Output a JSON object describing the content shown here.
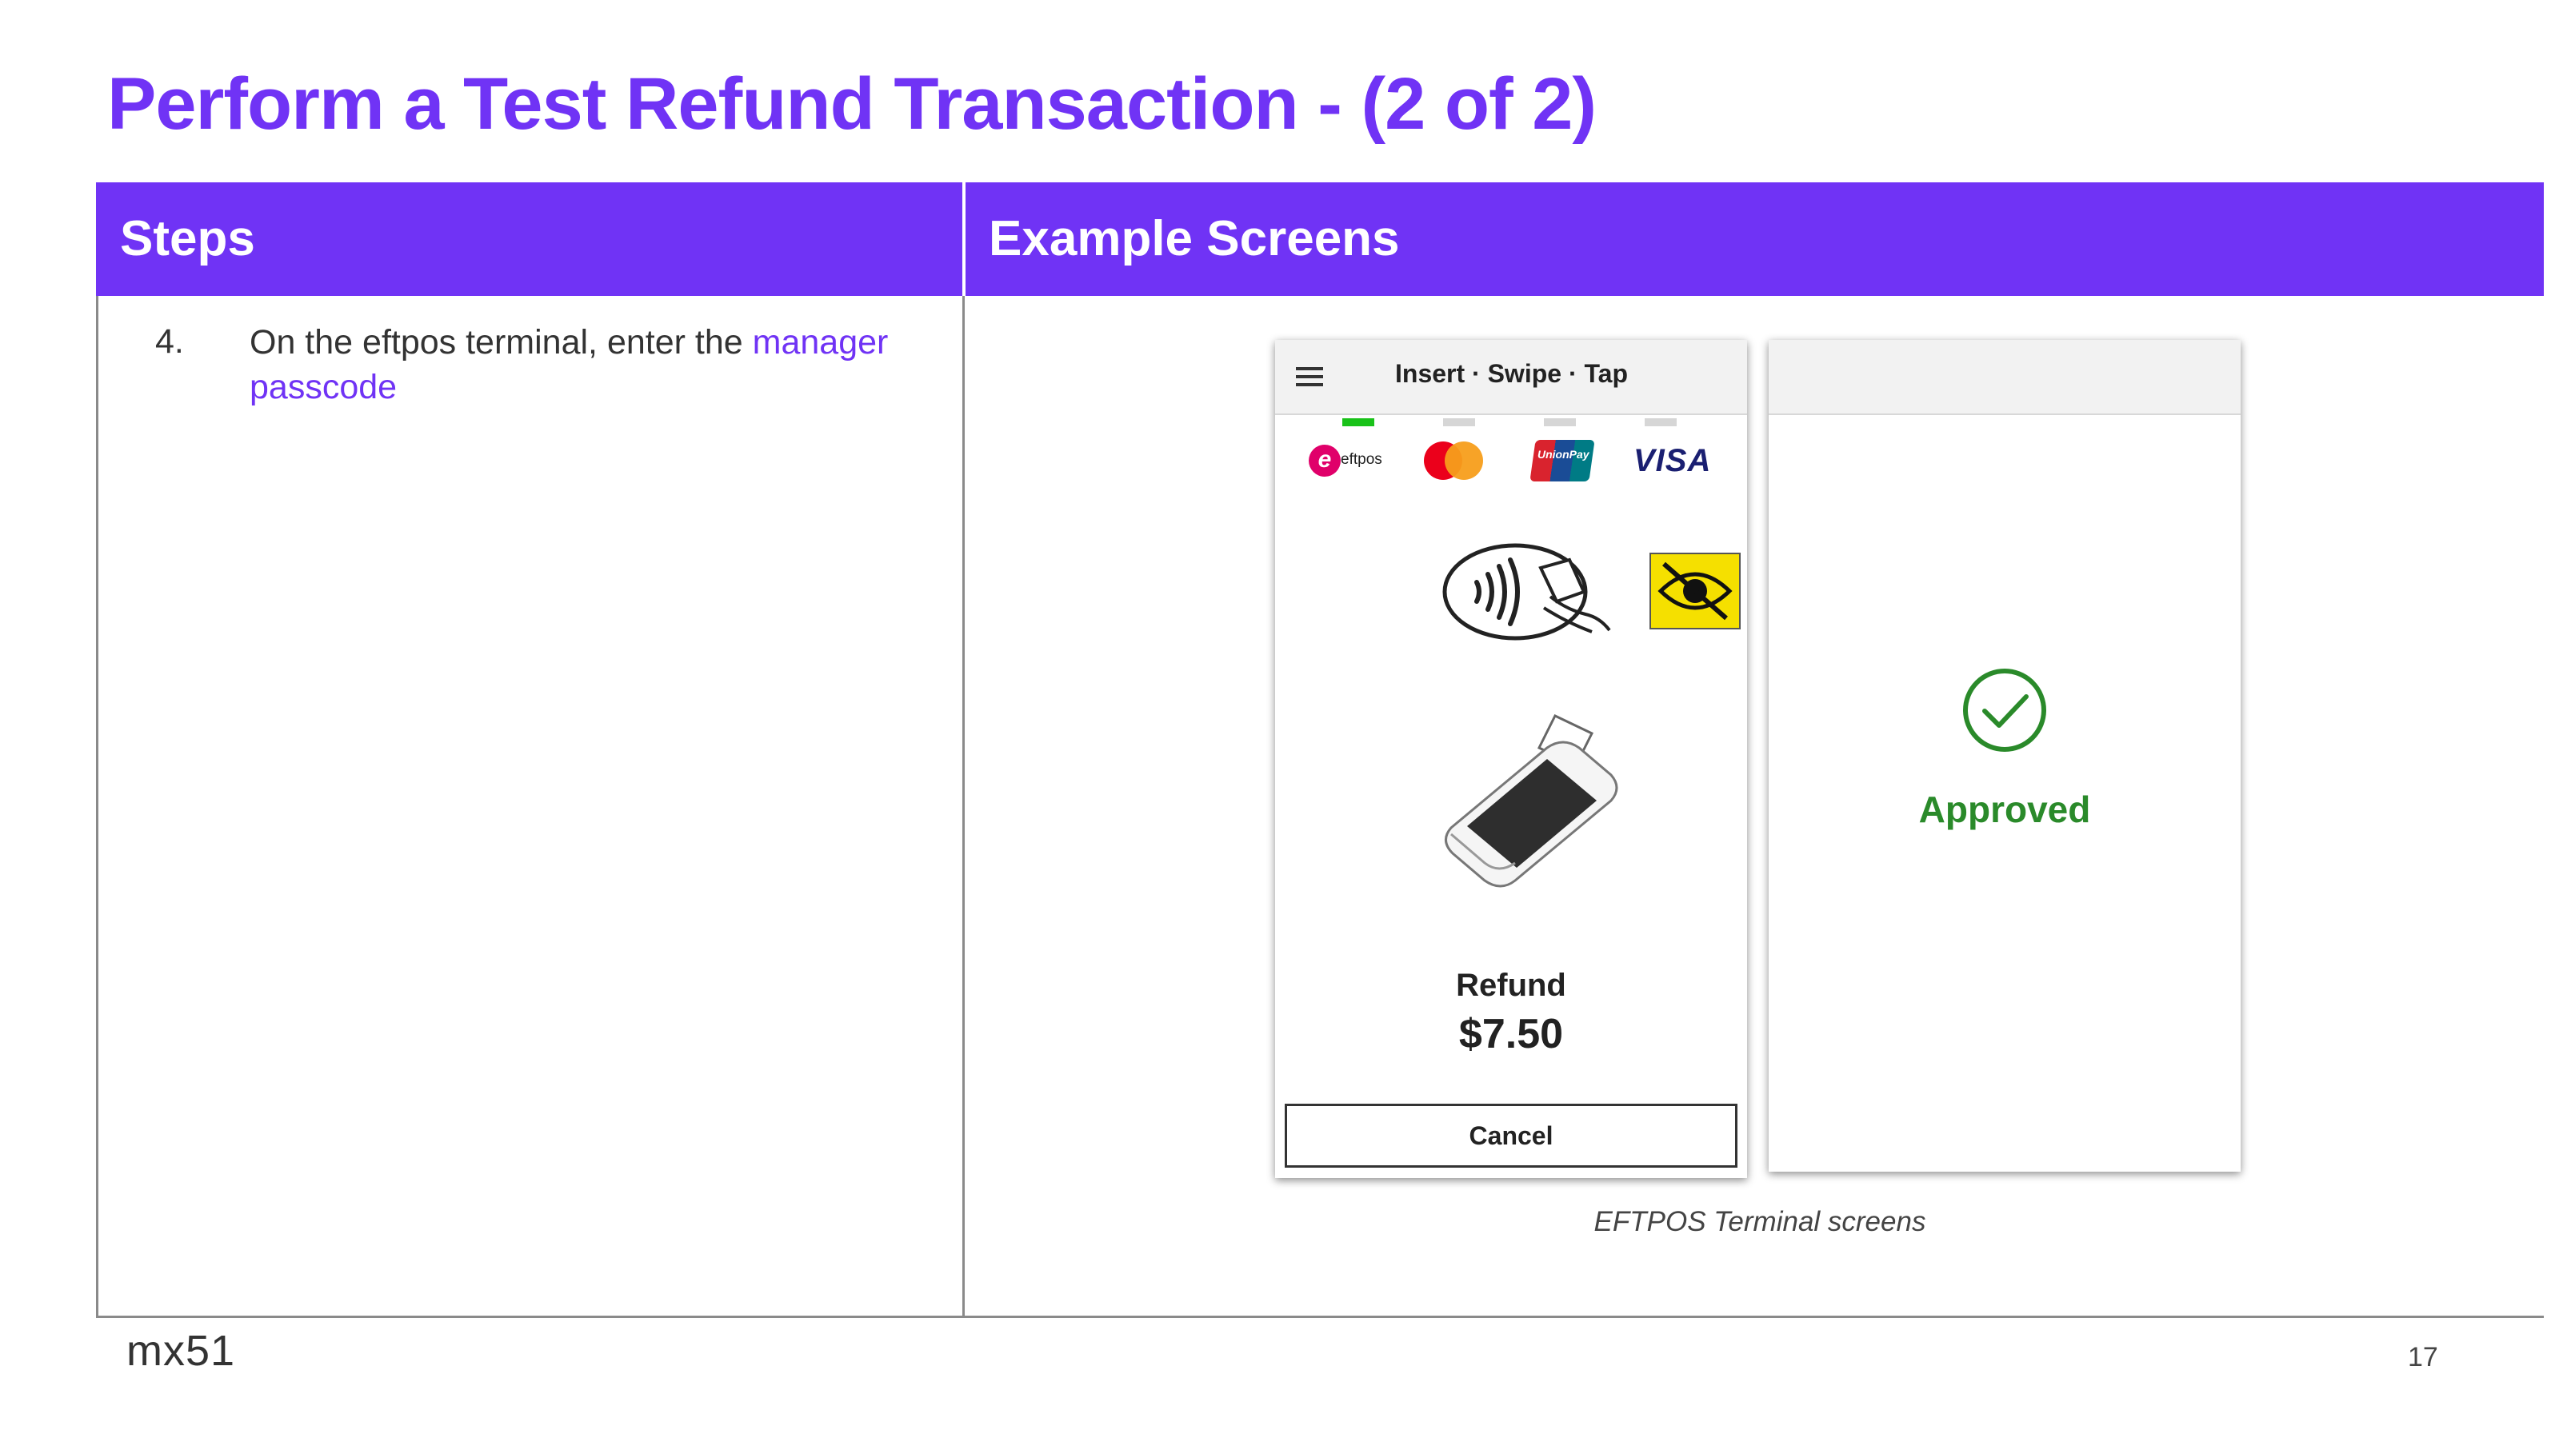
{
  "slide": {
    "title": "Perform a Test Refund Transaction - (2 of 2)",
    "page_number": "17",
    "footer_logo": "mx51"
  },
  "table": {
    "headers": [
      "Steps",
      "Example Screens"
    ],
    "steps": [
      {
        "number": "4.",
        "text_before": "On the eftpos terminal, enter the ",
        "highlight": "manager passcode",
        "highlight_color": "#7033f5"
      }
    ]
  },
  "terminal_screens": {
    "payment_screen": {
      "title": "Insert · Swipe · Tap",
      "menu_icon": "hamburger-menu-icon",
      "brands": [
        {
          "name": "eftpos",
          "icon": "eftpos-logo-icon"
        },
        {
          "name": "mastercard",
          "icon": "mastercard-logo-icon"
        },
        {
          "name": "UnionPay",
          "icon": "unionpay-logo-icon"
        },
        {
          "name": "VISA",
          "icon": "visa-logo-icon"
        }
      ],
      "active_indicator": 0,
      "indicator_colors": {
        "active": "#19c219",
        "inactive": "#d6d6d6"
      },
      "contactless_icon": "contactless-tap-icon",
      "accessibility_icon": "no-eye-icon",
      "device_icon": "payment-terminal-icon",
      "transaction_type": "Refund",
      "amount": "$7.50",
      "cancel_label": "Cancel"
    },
    "result_screen": {
      "status_icon": "check-circle-icon",
      "status": "Approved",
      "status_color": "#2a8a2a"
    },
    "caption": "EFTPOS Terminal screens"
  },
  "colors": {
    "accent": "#7033f5",
    "header_text": "#ffffff",
    "body_text": "#333333"
  }
}
